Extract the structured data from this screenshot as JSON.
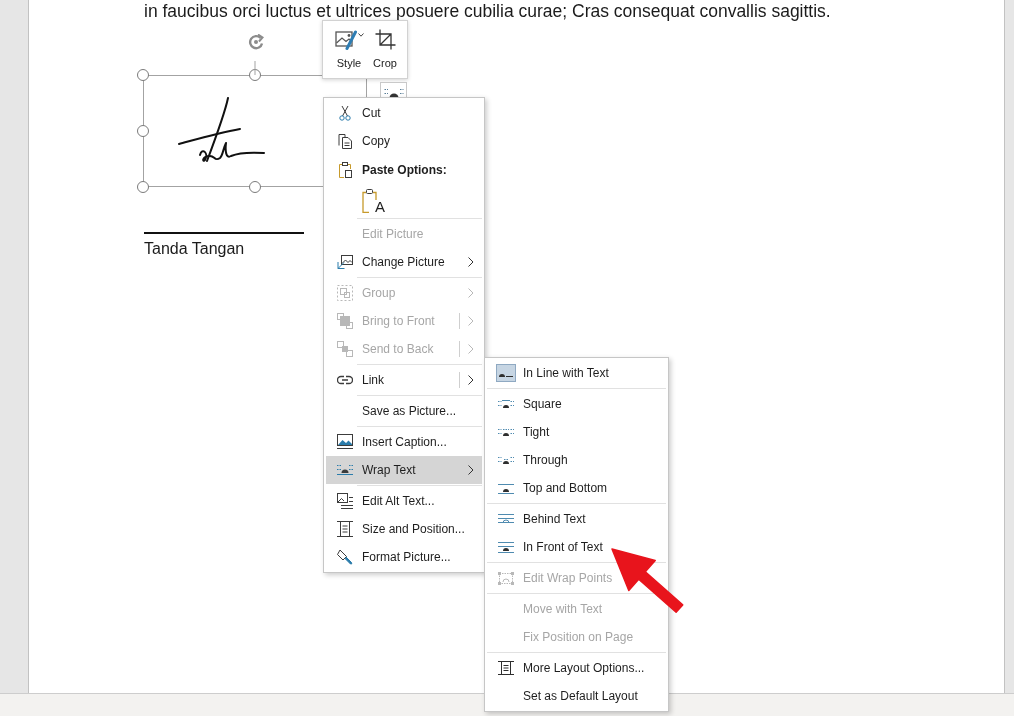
{
  "document": {
    "text": "in faucibus orci luctus et ultrices posuere cubilia curae; Cras consequat convallis sagittis.",
    "picture": {
      "selected": true
    },
    "signature_caption": "Tanda Tangan"
  },
  "mini_toolbar": {
    "buttons": [
      {
        "label": "Style",
        "dropdown": true
      },
      {
        "label": "Crop",
        "dropdown": false
      }
    ]
  },
  "context_menu": {
    "groups": [
      [
        {
          "kind": "command",
          "label": "Cut",
          "disabled": false,
          "selected": false
        },
        {
          "kind": "command",
          "label": "Copy",
          "disabled": false,
          "selected": false
        },
        {
          "kind": "heading",
          "label": "Paste Options:",
          "disabled": false,
          "selected": false
        },
        {
          "kind": "paste_options",
          "options": [
            {
              "label": "A"
            }
          ],
          "disabled": false,
          "selected": false
        }
      ],
      [
        {
          "kind": "command",
          "label": "Edit Picture",
          "disabled": true,
          "selected": false
        },
        {
          "kind": "submenu",
          "label": "Change Picture",
          "disabled": false,
          "selected": false
        }
      ],
      [
        {
          "kind": "submenu",
          "label": "Group",
          "disabled": true,
          "selected": false
        },
        {
          "kind": "split_submenu",
          "label": "Bring to Front",
          "disabled": true,
          "selected": false
        },
        {
          "kind": "split_submenu",
          "label": "Send to Back",
          "disabled": true,
          "selected": false
        }
      ],
      [
        {
          "kind": "split_submenu",
          "label": "Link",
          "disabled": false,
          "selected": false
        }
      ],
      [
        {
          "kind": "command",
          "label": "Save as Picture...",
          "disabled": false,
          "selected": false
        }
      ],
      [
        {
          "kind": "command",
          "label": "Insert Caption...",
          "disabled": false,
          "selected": false
        },
        {
          "kind": "submenu",
          "label": "Wrap Text",
          "disabled": false,
          "selected": true
        }
      ],
      [
        {
          "kind": "command",
          "label": "Edit Alt Text...",
          "disabled": false,
          "selected": false
        },
        {
          "kind": "command",
          "label": "Size and Position...",
          "disabled": false,
          "selected": false
        },
        {
          "kind": "command",
          "label": "Format Picture...",
          "disabled": false,
          "selected": false
        }
      ]
    ]
  },
  "wrap_text_submenu": {
    "groups": [
      [
        {
          "label": "In Line with Text",
          "disabled": false,
          "selected": true
        }
      ],
      [
        {
          "label": "Square",
          "disabled": false,
          "selected": false
        },
        {
          "label": "Tight",
          "disabled": false,
          "selected": false
        },
        {
          "label": "Through",
          "disabled": false,
          "selected": false
        },
        {
          "label": "Top and Bottom",
          "disabled": false,
          "selected": false
        }
      ],
      [
        {
          "label": "Behind Text",
          "disabled": false,
          "selected": false
        },
        {
          "label": "In Front of Text",
          "disabled": false,
          "selected": false
        }
      ],
      [
        {
          "label": "Edit Wrap Points",
          "disabled": true,
          "selected": false
        }
      ],
      [
        {
          "label": "Move with Text",
          "disabled": true,
          "selected": false
        },
        {
          "label": "Fix Position on Page",
          "disabled": true,
          "selected": false
        }
      ],
      [
        {
          "label": "More Layout Options...",
          "disabled": false,
          "selected": false
        },
        {
          "label": "Set as Default Layout",
          "disabled": false,
          "selected": false
        }
      ]
    ]
  }
}
